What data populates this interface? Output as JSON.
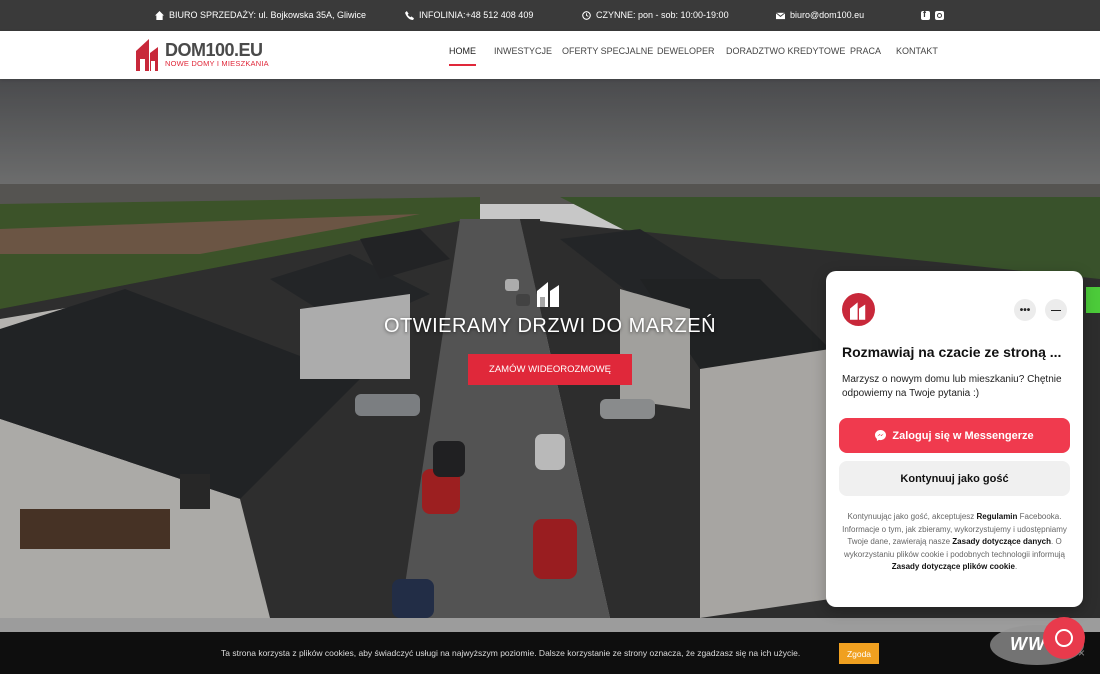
{
  "topbar": {
    "office": "BIURO SPRZEDAŻY: ul. Bojkowska 35A, Gliwice",
    "phone": "INFOLINIA:+48 512 408 409",
    "hours": "CZYNNE: pon - sob: 10:00-19:00",
    "email": "biuro@dom100.eu",
    "social_icons": [
      "facebook-icon",
      "instagram-icon"
    ]
  },
  "header": {
    "logo_title": "DOM100.EU",
    "logo_sub": "NOWE DOMY I MIESZKANIA",
    "nav": [
      "HOME",
      "INWESTYCJE",
      "OFERTY SPECJALNE",
      "DEWELOPER",
      "DORADZTWO KREDYTOWE",
      "PRACA",
      "KONTAKT"
    ],
    "active": "HOME"
  },
  "hero": {
    "title": "OTWIERAMY DRZWI DO MARZEŃ",
    "button": "ZAMÓW WIDEOROZMOWĘ"
  },
  "cookie": {
    "text": "Ta strona korzysta z plików cookies, aby świadczyć usługi na najwyższym poziomie. Dalsze korzystanie ze strony oznacza, że zgadzasz się na ich użycie.",
    "button": "Zgoda",
    "close": "×"
  },
  "chat": {
    "menu_more": "•••",
    "menu_min": "—",
    "title": "Rozmawiaj na czacie ze stroną ...",
    "description": "Marzysz o nowym domu lub mieszkaniu? Chętnie odpowiemy na Twoje pytania :)",
    "login_button": "Zaloguj się w Messengerze",
    "guest_button": "Kontynuuj jako gość",
    "legal_1": "Kontynuując jako gość, akceptujesz",
    "legal_link1": "Regulamin",
    "legal_2": "Facebooka. Informacje o tym, jak zbieramy, wykorzystujemy i udostępniamy Twoje dane, zawierają nasze",
    "legal_link2": "Zasady dotyczące danych",
    "legal_3": ". O wykorzystaniu plików cookie i podobnych technologii informują",
    "legal_link3": "Zasady dotyczące plików cookie",
    "legal_4": "."
  },
  "badge": {
    "text": "WWW"
  },
  "colors": {
    "accent": "#e0283a",
    "topbar": "#3a3a3a",
    "cookie_button": "#f0a020",
    "messenger": "#f03a4e"
  }
}
